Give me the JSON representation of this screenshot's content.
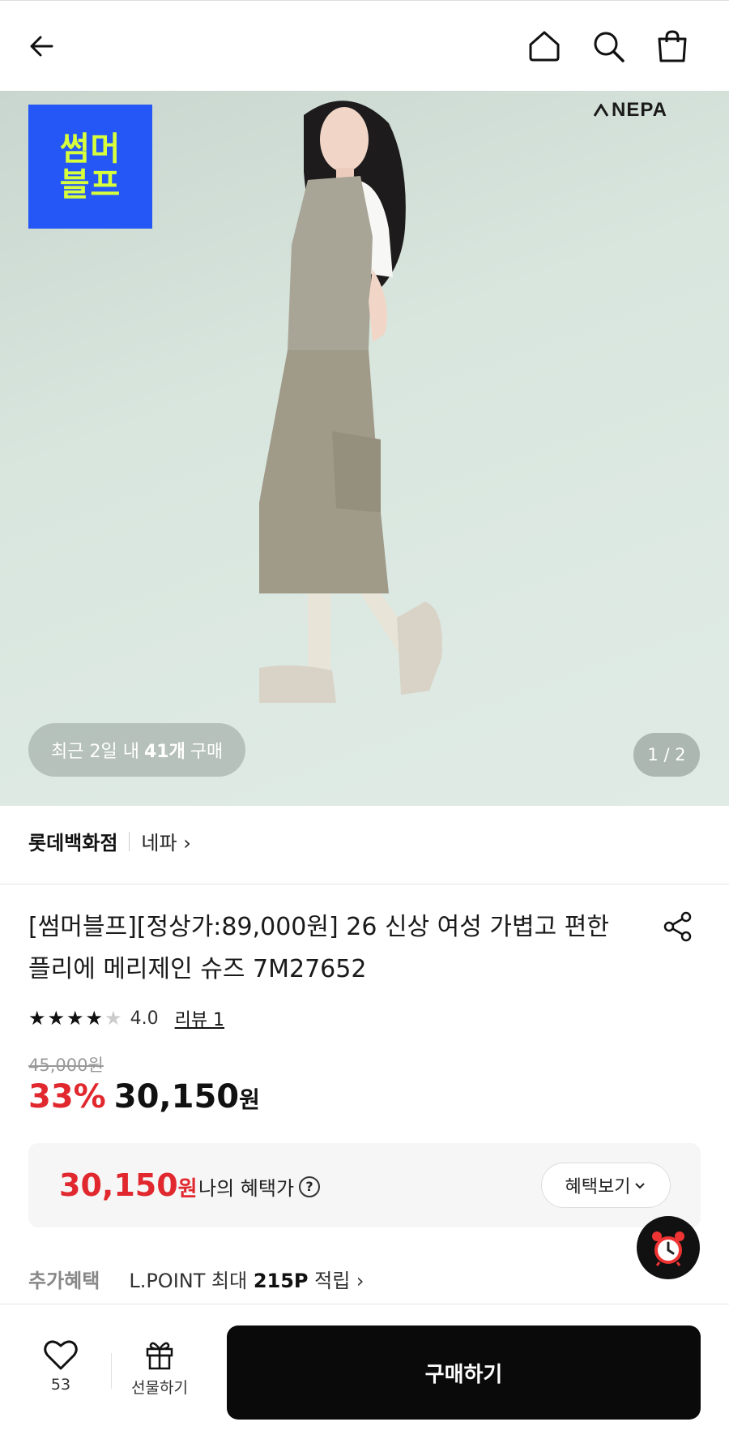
{
  "header": {
    "back_icon": "arrow-left-icon",
    "home_icon": "home-icon",
    "search_icon": "search-icon",
    "cart_icon": "shopping-bag-icon"
  },
  "hero": {
    "promo_badge_line1": "썸머",
    "promo_badge_line2": "블프",
    "brand_logo": "NEPA",
    "recent_purchase": {
      "prefix": "최근 2일 내",
      "count": "41개",
      "suffix": "구매"
    },
    "page_indicator": "1 / 2"
  },
  "store": {
    "name": "롯데백화점",
    "brand_link": "네파 ›"
  },
  "product": {
    "title": "[썸머블프][정상가:89,000원] 26 신상 여성 가볍고 편한 플리에 메리제인 슈즈 7M27652",
    "rating": 4.0,
    "rating_text": "4.0",
    "review_link": "리뷰 1",
    "original_price": "45,000원",
    "discount": "33%",
    "price": "30,150",
    "price_unit": "원"
  },
  "benefit": {
    "price": "30,150",
    "unit": "원",
    "label": "나의 혜택가",
    "help_icon": "?",
    "button_label": "혜택보기"
  },
  "extra": {
    "label": "추가혜택",
    "prefix": "L.POINT 최대",
    "points": "215P",
    "suffix": "적립 ›"
  },
  "bottom_bar": {
    "like_count": "53",
    "gift_label": "선물하기",
    "buy_label": "구매하기"
  },
  "colors": {
    "accent_red": "#e0282e",
    "promo_blue": "#2457f5",
    "promo_yellow": "#d7ff3b",
    "buy_button": "#0a0a0a"
  }
}
